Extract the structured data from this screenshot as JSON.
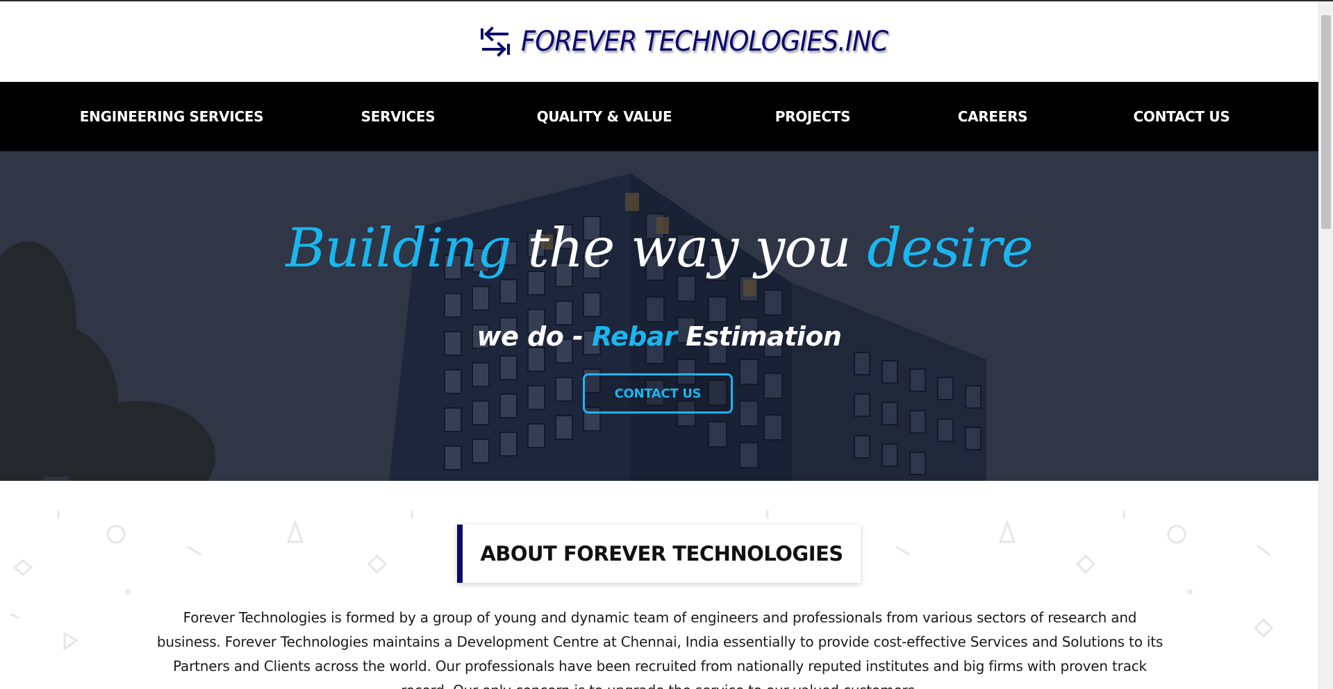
{
  "brand": {
    "name": "FOREVER TECHNOLOGIES.INC",
    "icon": "arrows-exchange-icon",
    "color": "#0b0a6e"
  },
  "nav": {
    "items": [
      {
        "label": "ENGINEERING SERVICES"
      },
      {
        "label": "SERVICES"
      },
      {
        "label": "QUALITY & VALUE"
      },
      {
        "label": "PROJECTS"
      },
      {
        "label": "CAREERS"
      },
      {
        "label": "CONTACT US"
      }
    ]
  },
  "hero": {
    "title_part1": "Building",
    "title_part2": " the way you ",
    "title_part3": "desire",
    "subtitle_part1": "we do - ",
    "subtitle_part2": "Rebar",
    "subtitle_part3": " Estimation",
    "button_label": "CONTACT US",
    "accent_color": "#1ab6f0"
  },
  "about": {
    "heading": "ABOUT FOREVER TECHNOLOGIES",
    "lines": [
      "Forever Technologies is formed by a group of young and dynamic team of engineers and professionals from various sectors of research and",
      "business. Forever Technologies maintains a Development Centre at Chennai, India essentially to provide cost-effective Services and Solutions to its",
      "Partners and Clients across the world. Our professionals have been recruited from nationally reputed institutes and big firms with proven track",
      "record. Our only concern is to upgrade the service to our valued customers."
    ]
  }
}
